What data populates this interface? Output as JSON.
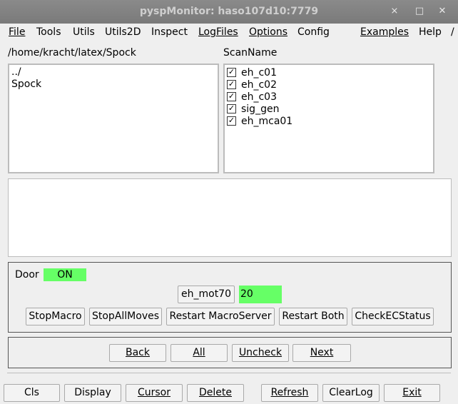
{
  "window": {
    "title": "pyspMonitor: haso107d10:7779",
    "btn_min": "✕",
    "btn_restore": "□",
    "btn_close": "✕"
  },
  "menu": {
    "file": "File",
    "tools": "Tools",
    "utils": "Utils",
    "utils2d": "Utils2D",
    "inspect": "Inspect",
    "logfiles": "LogFiles",
    "options": "Options",
    "config": "Config",
    "examples": "Examples",
    "help": "Help",
    "slash": "/"
  },
  "dir": {
    "path": "/home/kracht/latex/Spock",
    "items": [
      "../",
      "Spock"
    ]
  },
  "scans": {
    "header": "ScanName",
    "items": [
      "eh_c01",
      "eh_c02",
      "eh_c03",
      "sig_gen",
      "eh_mca01"
    ],
    "check": "✓"
  },
  "door": {
    "label": "Door",
    "state": "ON"
  },
  "motor": {
    "name": "eh_mot70",
    "value": "20"
  },
  "macro_buttons": [
    "StopMacro",
    "StopAllMoves",
    "Restart MacroServer",
    "Restart Both",
    "CheckECStatus"
  ],
  "nav_buttons": [
    "Back",
    "All",
    "Uncheck",
    "Next"
  ],
  "bottom_buttons": [
    "Cls",
    "Display",
    "Cursor",
    "Delete",
    "Refresh",
    "ClearLog",
    "Exit"
  ],
  "colors": {
    "status_green": "#66ff66",
    "titlebar": "#808080"
  }
}
